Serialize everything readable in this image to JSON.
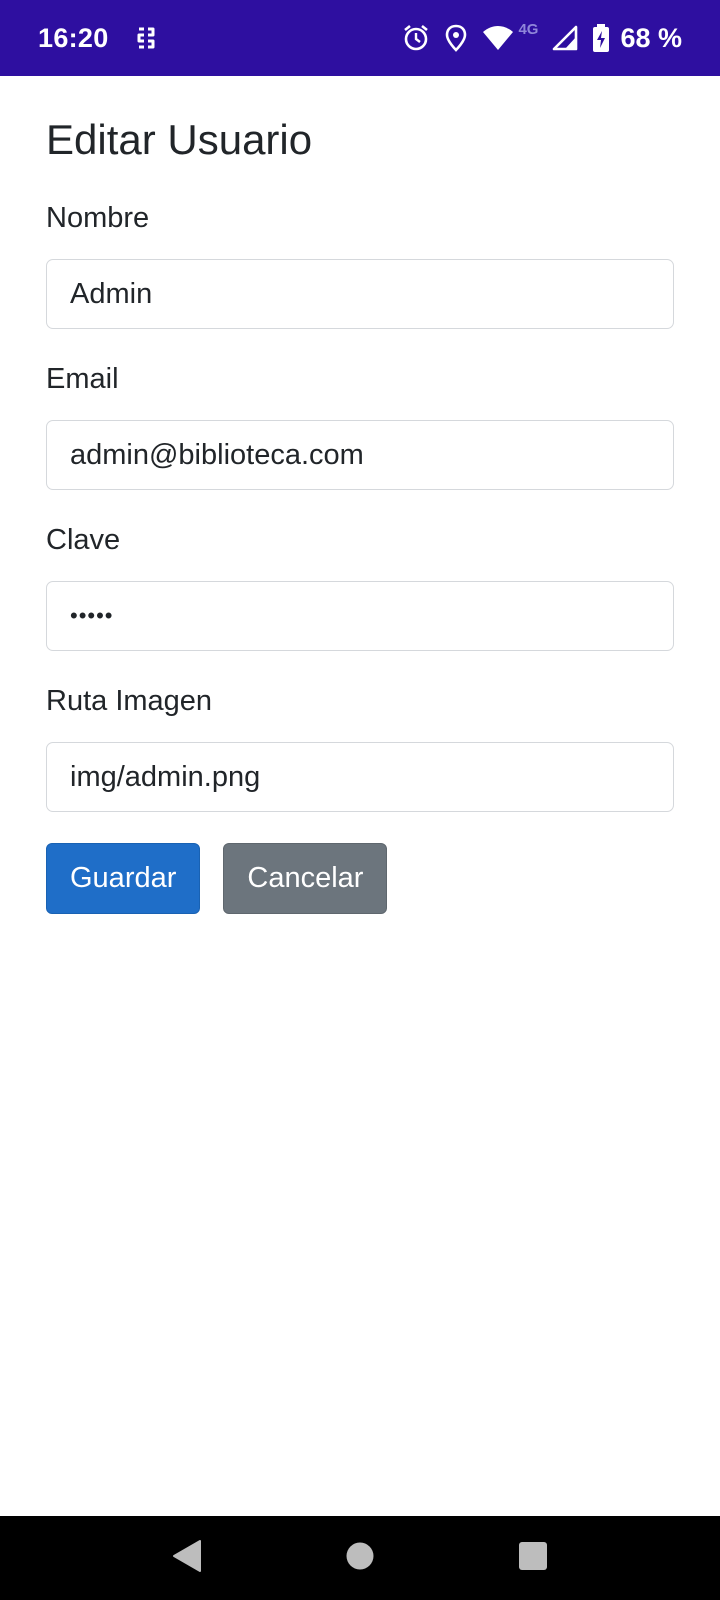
{
  "status_bar": {
    "time": "16:20",
    "network_type": "4G",
    "battery": "68 %",
    "icons": [
      "keyguard-s-icon",
      "alarm-icon",
      "location-icon",
      "wifi-icon",
      "signal-icon",
      "battery-charging-icon"
    ]
  },
  "form": {
    "title": "Editar Usuario",
    "fields": [
      {
        "label": "Nombre",
        "value": "Admin"
      },
      {
        "label": "Email",
        "value": "admin@biblioteca.com"
      },
      {
        "label": "Clave",
        "value": "•••••"
      },
      {
        "label": "Ruta Imagen",
        "value": "img/admin.png"
      }
    ],
    "buttons": {
      "save": "Guardar",
      "cancel": "Cancelar"
    }
  },
  "colors": {
    "status_bar": "#2e0fa0",
    "primary_button": "#1f6ec8",
    "secondary_button": "#6c757d"
  },
  "nav_bar": {
    "icons": [
      "back-icon",
      "home-icon",
      "recents-icon"
    ]
  }
}
